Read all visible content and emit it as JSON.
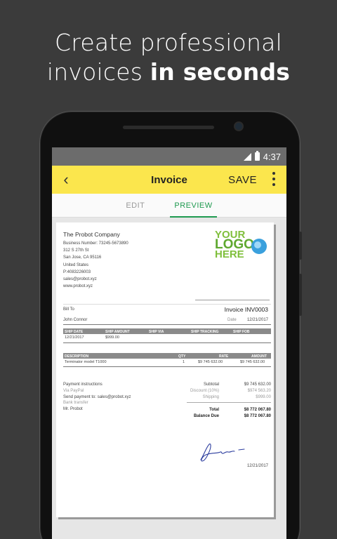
{
  "headline": {
    "line1": "Create professional",
    "line2_regular": "invoices ",
    "line2_bold": "in seconds"
  },
  "statusbar": {
    "time": "4:37"
  },
  "appbar": {
    "back": "‹",
    "title": "Invoice",
    "save": "SAVE"
  },
  "tabs": [
    {
      "label": "EDIT"
    },
    {
      "label": "PREVIEW"
    }
  ],
  "company": {
    "name": "The Probot Company",
    "lines": [
      "Business Number: 73245-5673890",
      "312 S 27th St",
      "San Jose, CA 95116",
      "United States",
      "P:4083226003",
      "sales@probot.xyz",
      "www.probot.xyz"
    ]
  },
  "logo": {
    "line1": "YOUR",
    "line2": "LOGO",
    "line3": "HERE"
  },
  "invoice": {
    "bill_to_label": "Bill To",
    "number": "Invoice INV0003",
    "client": "John Connor",
    "date_label": "Date",
    "date": "12/21/2017"
  },
  "ship_table": {
    "headers": [
      "SHIP DATE",
      "SHIP AMOUNT",
      "SHIP VIA",
      "SHIP TRACKING",
      "SHIP FOB"
    ],
    "row": [
      "12/21/2017",
      "$999.00"
    ]
  },
  "items_table": {
    "headers": [
      "DESCRIPTION",
      "QTY",
      "RATE",
      "AMOUNT"
    ],
    "row": [
      "Terminator model T1000",
      "1",
      "$9 745 632.00",
      "$9 745 632.00"
    ]
  },
  "payment": {
    "title": "Payment instructions",
    "via": "Via PayPal",
    "send": "Send payment to: sales@probot.xyz",
    "bank": "Bank transfer",
    "name": "Mr. Probot"
  },
  "totals": {
    "subtotal_label": "Subtotal",
    "subtotal": "$9 745 632.00",
    "discount_label": "Discount (10%)",
    "discount": "$974 563.20",
    "shipping_label": "Shipping",
    "shipping": "$999.00",
    "total_label": "Total",
    "total": "$8 772 067.80",
    "balance_label": "Balance Due",
    "balance": "$8 772 067.80"
  },
  "signature_date": "12/21/2017"
}
